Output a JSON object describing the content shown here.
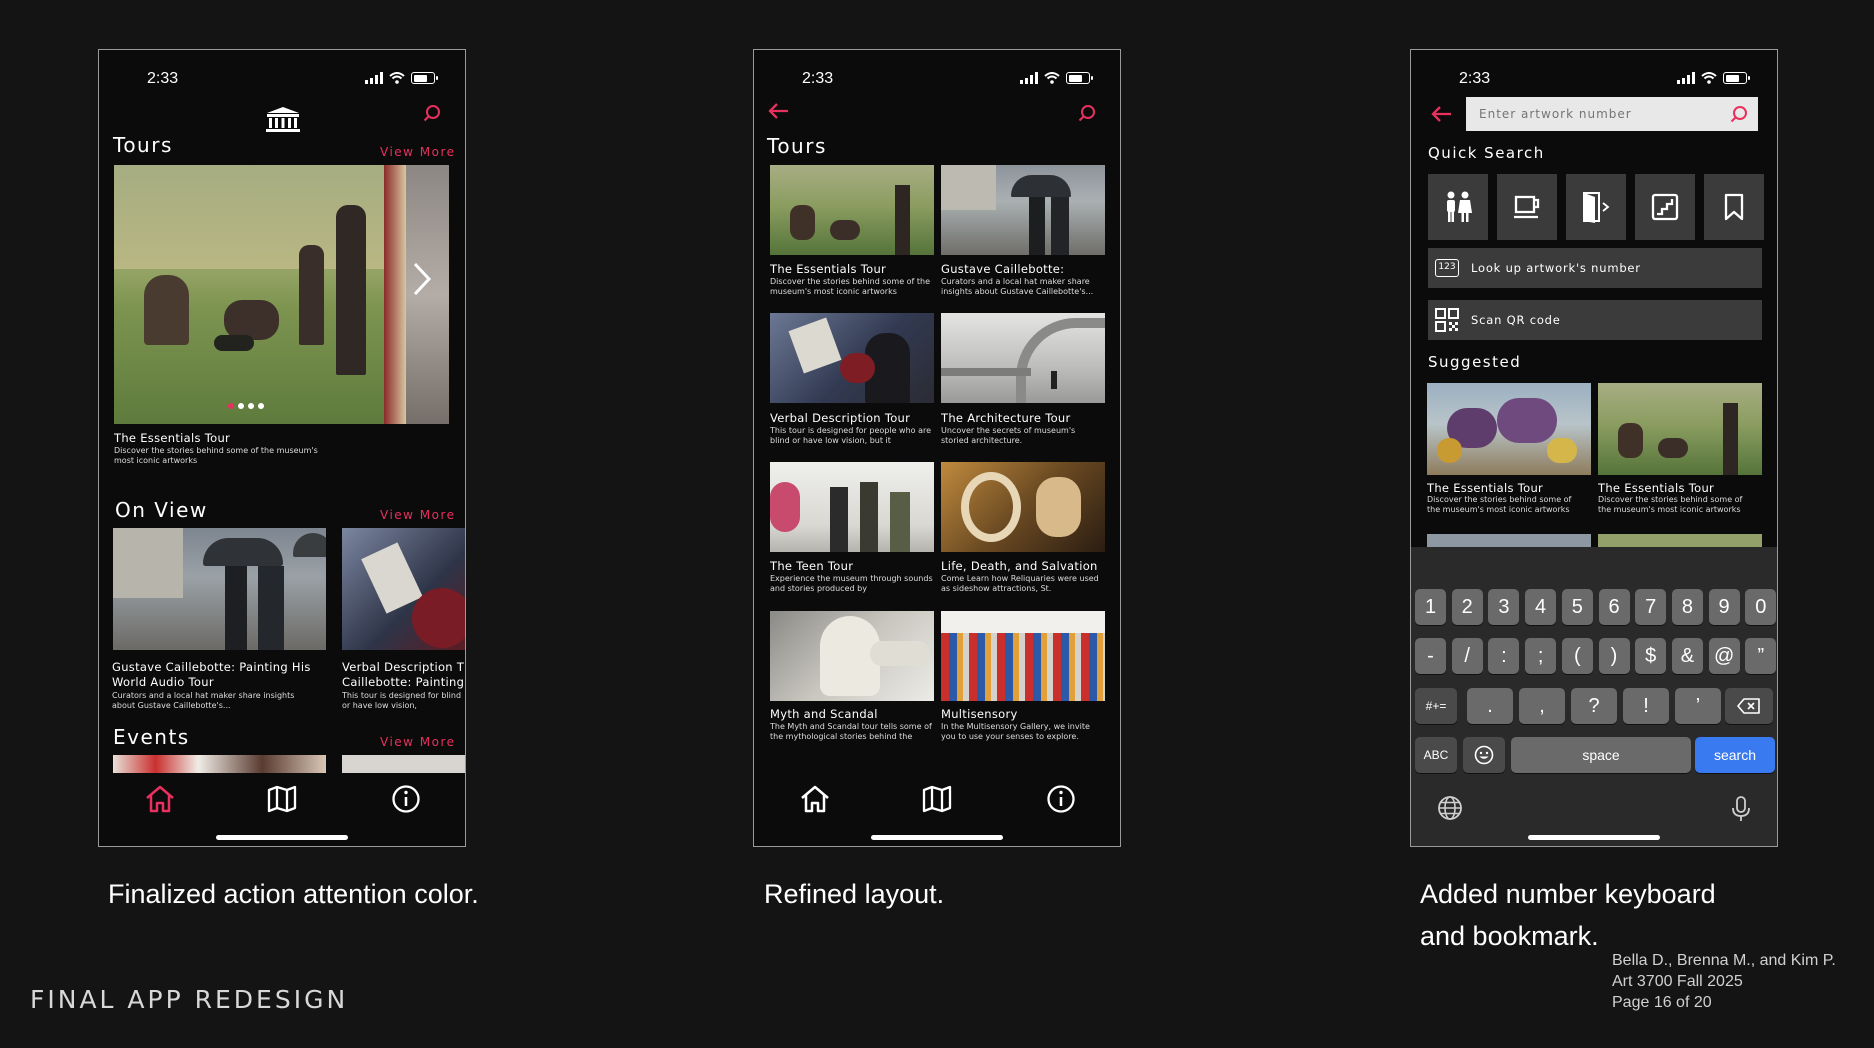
{
  "status": {
    "time": "2:33"
  },
  "colors": {
    "accent": "#e8305e",
    "background": "#141414",
    "phone_bg": "#0b0b0b",
    "search_key": "#3a7af0"
  },
  "phone1": {
    "tours_title": "Tours",
    "view_more": "View More",
    "hero": {
      "title": "The Essentials Tour",
      "desc": "Discover the stories behind some of the museum's most iconic artworks"
    },
    "on_view_title": "On View",
    "on_view": [
      {
        "title": "Gustave Caillebotte: Painting His World Audio Tour",
        "desc": "Curators and a local hat maker share insights about Gustave Caillebotte's..."
      },
      {
        "title": "Verbal Description T Caillebotte: Painting",
        "desc": "This tour is designed for blind or have low vision,"
      }
    ],
    "events_title": "Events",
    "tabs": {
      "home": "home-icon",
      "map": "map-icon",
      "info": "info-icon"
    }
  },
  "phone2": {
    "tours_title": "Tours",
    "tours": [
      {
        "title": "The Essentials Tour",
        "desc": "Discover the stories behind some of the museum's most iconic artworks"
      },
      {
        "title": "Gustave Caillebotte:",
        "desc": "Curators and a local hat maker share insights about Gustave Caillebotte's..."
      },
      {
        "title": "Verbal Description Tour",
        "desc": "This tour is designed for people who are blind or have low vision, but it"
      },
      {
        "title": "The Architecture Tour",
        "desc": "Uncover the secrets of museum's storied architecture."
      },
      {
        "title": "The Teen Tour",
        "desc": "Experience the museum through sounds and stories produced by"
      },
      {
        "title": "Life, Death, and Salvation",
        "desc": "Come Learn how Reliquaries were used as sideshow attractions, St."
      },
      {
        "title": "Myth and Scandal",
        "desc": "The Myth and Scandal tour tells some of the mythological stories behind the"
      },
      {
        "title": "Multisensory",
        "desc": "In the Multisensory Gallery, we invite you to use your senses to explore."
      }
    ]
  },
  "phone3": {
    "search_placeholder": "Enter artwork number",
    "quick_search_title": "Quick Search",
    "quick_icons": [
      "restroom-icon",
      "cafe-icon",
      "exit-icon",
      "stairs-icon",
      "bookmark-icon"
    ],
    "lookup_label": "Look up artwork's number",
    "lookup_icon_text": "123",
    "scan_label": "Scan QR code",
    "suggested_title": "Suggested",
    "suggested": [
      {
        "title": "The Essentials Tour",
        "desc": "Discover the stories behind some of the museum's most iconic artworks"
      },
      {
        "title": "The Essentials Tour",
        "desc": "Discover the stories behind some of the museum's most iconic artworks"
      }
    ],
    "keyboard": {
      "row1": [
        "1",
        "2",
        "3",
        "4",
        "5",
        "6",
        "7",
        "8",
        "9",
        "0"
      ],
      "row2": [
        "-",
        "/",
        ":",
        ";",
        "(",
        ")",
        "$",
        "&",
        "@",
        "”"
      ],
      "row3_toggle": "#+=",
      "row3": [
        ".",
        ",",
        "?",
        "!",
        "’"
      ],
      "abc": "ABC",
      "space": "space",
      "search": "search"
    }
  },
  "captions": {
    "c1": "Finalized action attention color.",
    "c2": "Refined layout.",
    "c3_line1": "Added number keyboard",
    "c3_line2": "and bookmark."
  },
  "footer_title": "FINAL APP REDESIGN",
  "credits": [
    "Bella D., Brenna M., and Kim P.",
    "Art 3700 Fall 2025",
    "Page 16 of 20"
  ]
}
